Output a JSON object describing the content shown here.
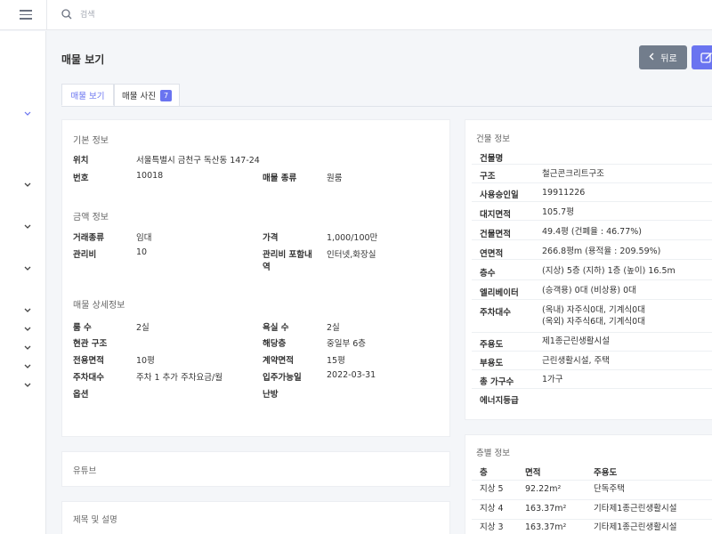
{
  "search": {
    "placeholder": "검색"
  },
  "page": {
    "title": "매물 보기",
    "back_label": "뒤로"
  },
  "tabs": {
    "view": "매물 보기",
    "photos": "매물 사진",
    "photo_count": "7"
  },
  "basic": {
    "heading": "기본 정보",
    "location_label": "위치",
    "location_value": "서울특별시 금천구 독산동 147-24",
    "number_label": "번호",
    "number_value": "10018",
    "type_label": "매물 종류",
    "type_value": "원룸"
  },
  "price": {
    "heading": "금액 정보",
    "deal_label": "거래종류",
    "deal_value": "임대",
    "price_label": "가격",
    "price_value": "1,000/100만",
    "fee_label": "관리비",
    "fee_value": "10",
    "fee_incl_label_1": "관리비 포함내",
    "fee_incl_label_2": "역",
    "fee_incl_value": "인터넷,화장실"
  },
  "detail": {
    "heading": "매물 상세정보",
    "rooms_label": "룸 수",
    "rooms_value": "2실",
    "baths_label": "욕실 수",
    "baths_value": "2실",
    "structure_label": "현관 구조",
    "floor_label": "해당층",
    "floor_value": "중일부 6층",
    "area_label": "전용면적",
    "area_value": "10평",
    "contract_label": "계약면적",
    "contract_value": "15평",
    "parking_label": "주차대수",
    "parking_value": "주차 1 추가 주차요금/월",
    "movein_label": "입주가능일",
    "movein_value": "2022-03-31",
    "options_label": "옵션",
    "heating_label": "난방"
  },
  "youtube": {
    "heading": "유튜브"
  },
  "description": {
    "heading": "제목 및 설명"
  },
  "building": {
    "heading": "건물 정보",
    "rows": [
      {
        "label": "건물명",
        "value": ""
      },
      {
        "label": "구조",
        "value": "철근콘크리트구조"
      },
      {
        "label": "사용승인일",
        "value": "19911226"
      },
      {
        "label": "대지면적",
        "value": "105.7평"
      },
      {
        "label": "건물면적",
        "value": "49.4평 (건폐율 : 46.77%)"
      },
      {
        "label": "연면적",
        "value": "266.8평m (용적율 : 209.59%)"
      },
      {
        "label": "층수",
        "value": "(지상) 5층 (지하) 1층 (높이) 16.5m"
      },
      {
        "label": "엘리베이터",
        "value": "(승객용) 0대 (비상용) 0대"
      },
      {
        "label": "주차대수",
        "value": "(옥내) 자주식0대, 기계식0대",
        "value2": "(옥외) 자주식6대, 기계식0대"
      },
      {
        "label": "주용도",
        "value": "제1종근린생활시설"
      },
      {
        "label": "부용도",
        "value": "근린생활시설, 주택"
      },
      {
        "label": "총 가구수",
        "value": "1가구"
      },
      {
        "label": "에너지등급",
        "value": ""
      }
    ]
  },
  "floors": {
    "heading": "층별 정보",
    "headers": [
      "층",
      "면적",
      "주용도"
    ],
    "rows": [
      {
        "floor": "지상 5",
        "area": "92.22m²",
        "use": "단독주택"
      },
      {
        "floor": "지상 4",
        "area": "163.37m²",
        "use": "기타제1종근린생활시설"
      },
      {
        "floor": "지상 3",
        "area": "163.37m²",
        "use": "기타제1종근린생활시설"
      }
    ]
  },
  "colors": {
    "accent": "#6a74f0",
    "back_button": "#727d8c",
    "background": "#f4f6f9"
  },
  "icons": [
    "hamburger-icon",
    "search-icon",
    "chevron-down-icon",
    "chevron-left-icon",
    "edit-icon"
  ]
}
